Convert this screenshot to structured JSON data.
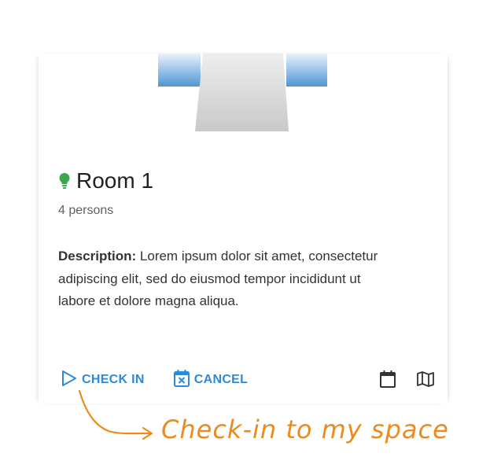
{
  "room": {
    "name": "Room 1",
    "capacity": "4 persons",
    "description_label": "Description:",
    "description_text": " Lorem ipsum dolor sit amet, consectetur adipiscing elit, sed do eiusmod tempor incididunt ut labore et dolore magna aliqua.",
    "status_icon": "lightbulb-icon",
    "status_color": "#3ca64a"
  },
  "actions": {
    "check_in_label": "CHECK IN",
    "check_in_icon": "play-outline-icon",
    "cancel_label": "CANCEL",
    "cancel_icon": "calendar-x-icon",
    "calendar_icon": "calendar-icon",
    "map_icon": "map-icon",
    "accent_color": "#2f89d9"
  },
  "annotation": {
    "text": "Check-in to my space",
    "color": "#ee8a1d"
  }
}
